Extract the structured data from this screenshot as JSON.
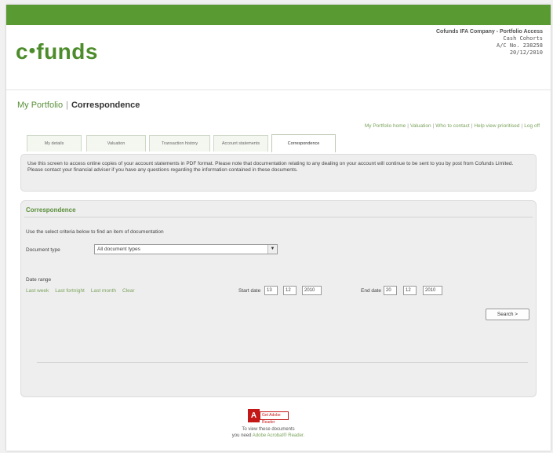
{
  "brand": {
    "logo_left": "c",
    "logo_right": "funds",
    "accent": "#5a9a33"
  },
  "account": {
    "line1": "Cofunds IFA Company - Portfolio Access",
    "line2": "Cash Cohorts",
    "line3": "A/C No. 238258",
    "line4": "20/12/2010"
  },
  "breadcrumb": {
    "parent": "My Portfolio",
    "separator": "|",
    "current": "Correspondence"
  },
  "top_links": [
    "My Portfolio home",
    "Valuation",
    "Who to contact",
    "Help view prioritised",
    "Log off"
  ],
  "tabs": [
    {
      "label": "My details",
      "active": false
    },
    {
      "label": "Valuation",
      "active": false
    },
    {
      "label": "Transaction history",
      "active": false
    },
    {
      "label": "Account statements",
      "active": false
    },
    {
      "label": "Correspondence",
      "active": true
    }
  ],
  "info_text": "Use this screen to access online copies of your account statements in PDF format. Please note that documentation relating to any dealing on your account will continue to be sent to you by post from Cofunds Limited. Please contact your financial adviser if you have any questions regarding the information contained in these documents.",
  "panel": {
    "title": "Correspondence",
    "help": "Use the select criteria below to find an item of documentation",
    "document_type_label": "Document type",
    "document_type_value": "All document types",
    "date_range_label": "Date range",
    "quick_links": [
      "Last week",
      "Last fortnight",
      "Last month",
      "Clear"
    ],
    "start_label": "Start date",
    "start": {
      "day": "13",
      "month": "12",
      "year": "2010"
    },
    "end_label": "End date",
    "end": {
      "day": "20",
      "month": "12",
      "year": "2010"
    },
    "search_label": "Search >"
  },
  "footer": {
    "badge_letter": "A",
    "badge_text": "Get Adobe Reader",
    "line1": "To view these documents",
    "line2_prefix": "you need",
    "line2_link": "Adobe Acrobat® Reader."
  }
}
